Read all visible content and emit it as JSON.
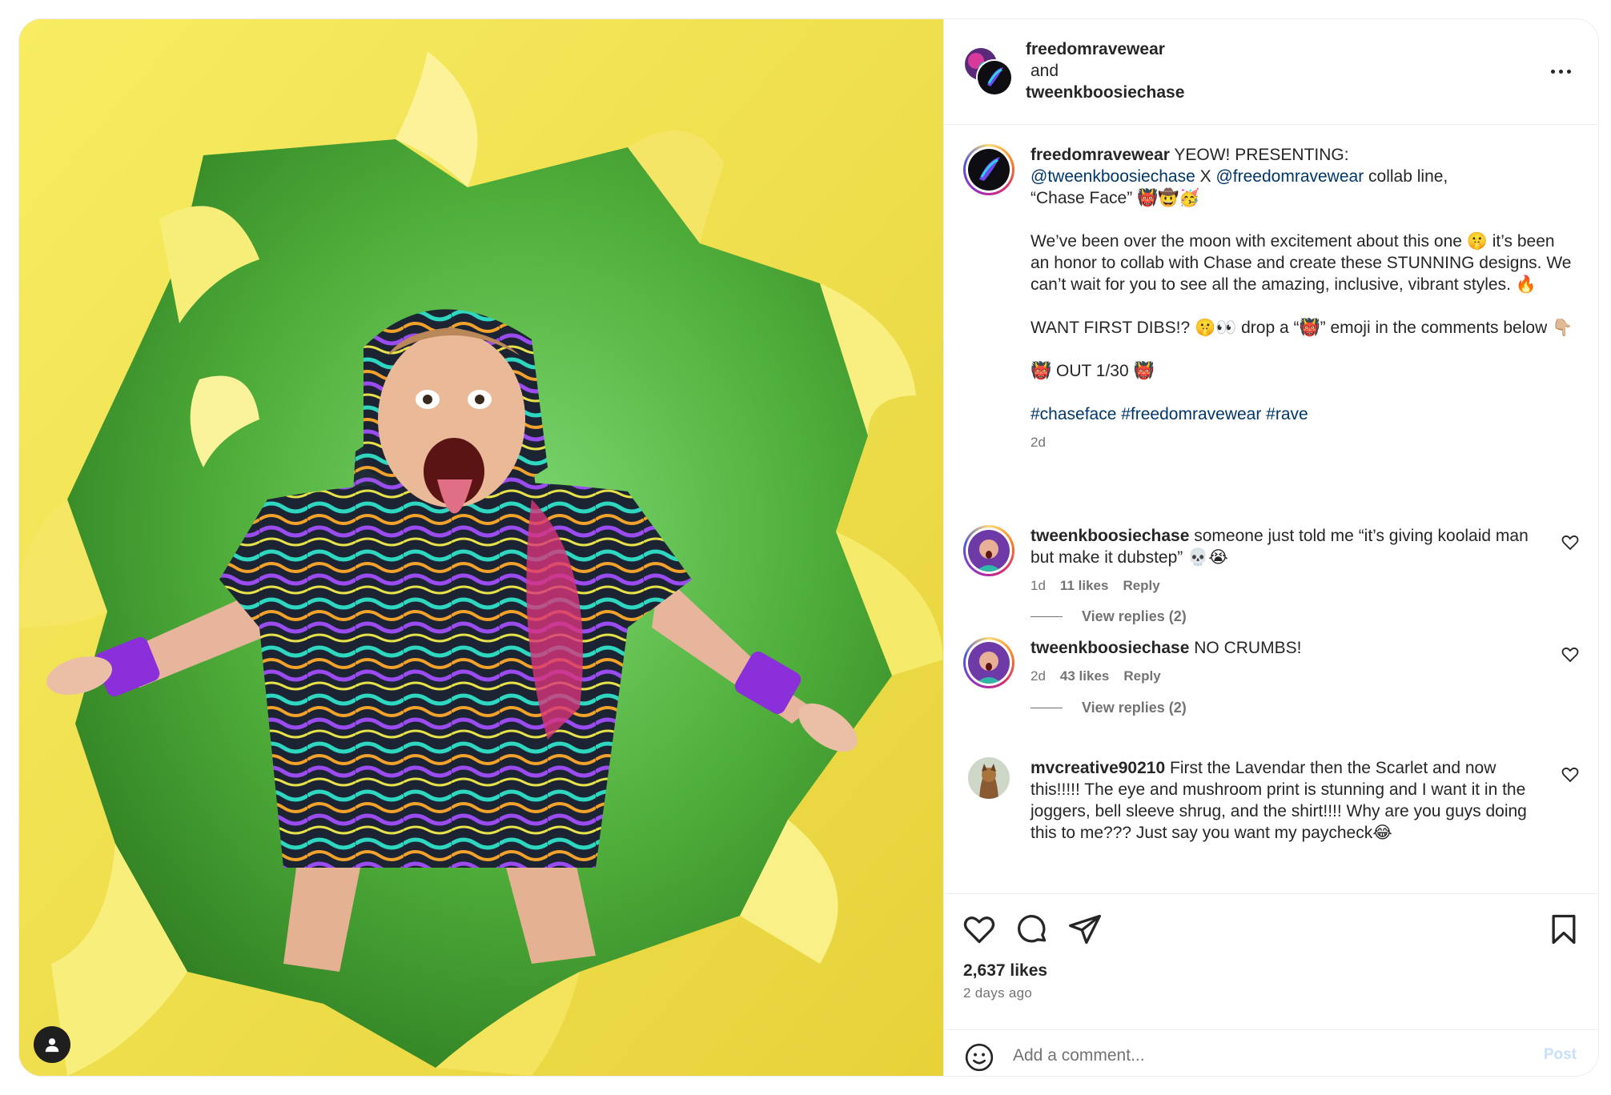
{
  "header": {
    "author_one": "freedomravewear",
    "joiner": "and",
    "author_two": "tweenkboosiechase"
  },
  "caption": {
    "username": "freedomravewear",
    "line_one": " YEOW! PRESENTING:",
    "mention_one": "@tweenkboosiechase",
    "x_sep": " X ",
    "mention_two": "@freedomravewear",
    "collab_text": " collab line,",
    "chase_face": "“Chase Face” 👹🤠🥳",
    "paragraph_two": "We’ve been over the moon with excitement about this one 🤫 it’s been an honor to collab with Chase and create these STUNNING designs. We can’t wait for you to see all the amazing, inclusive, vibrant styles. 🔥",
    "paragraph_three": "WANT FIRST DIBS!? 🤫👀 drop a “👹” emoji in the comments below 👇🏼",
    "paragraph_four": "👹 OUT 1/30 👹",
    "hashtags": "#chaseface #freedomravewear #rave",
    "age": "2d"
  },
  "comments": [
    {
      "username": "tweenkboosiechase",
      "text": " someone just told me “it’s giving koolaid man but make it dubstep” 💀😭",
      "age": "1d",
      "likes": "11 likes",
      "reply": "Reply",
      "view_replies": "View replies (2)"
    },
    {
      "username": "tweenkboosiechase",
      "text": " NO CRUMBS!",
      "age": "2d",
      "likes": "43 likes",
      "reply": "Reply",
      "view_replies": "View replies (2)"
    },
    {
      "username": "mvcreative90210",
      "text": " First the Lavendar then the Scarlet and now this!!!!! The eye and mushroom print is stunning and I want it in the joggers, bell sleeve shrug, and the shirt!!!! Why are you guys doing this to me??? Just say you want my paycheck😂"
    }
  ],
  "actions": {
    "icons": [
      "heart-icon",
      "comment-icon",
      "share-icon",
      "bookmark-icon"
    ],
    "likes_count": "2,637 likes",
    "posted": "2 days ago"
  },
  "composer": {
    "placeholder": "Add a comment...",
    "post_label": "Post"
  },
  "colors": {
    "paper_yellow": "#f3e54e",
    "backdrop_green": "#4fae3a",
    "link_blue": "#00376b",
    "muted_text": "#737373",
    "post_disabled": "#c7e0fb"
  }
}
